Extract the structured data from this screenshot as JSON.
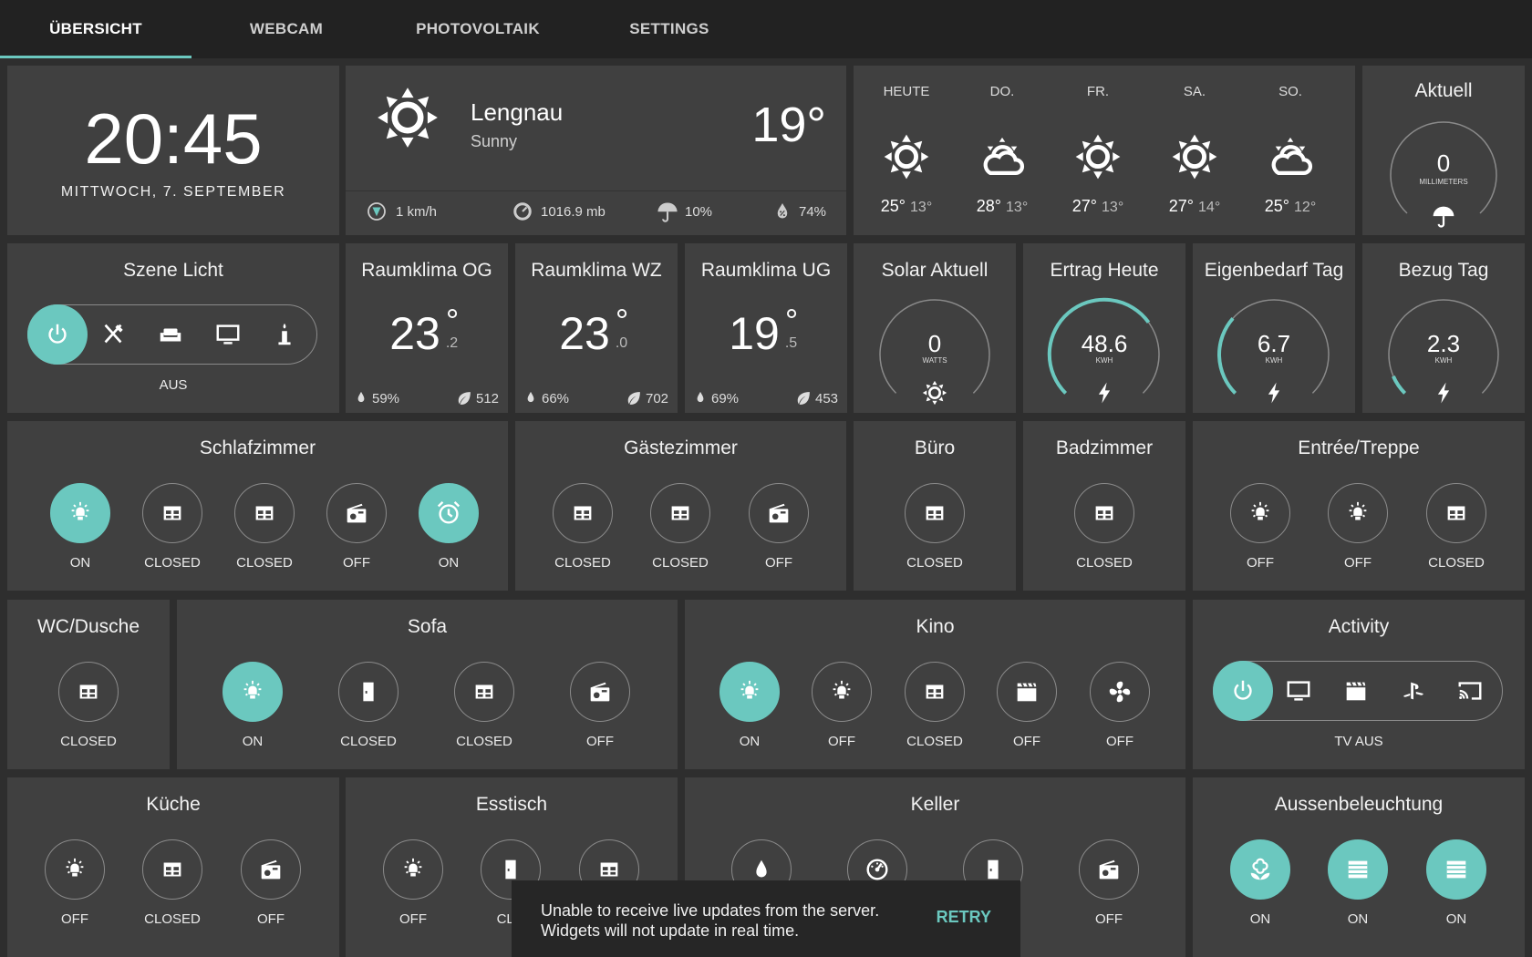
{
  "tabs": [
    "ÜBERSICHT",
    "WEBCAM",
    "PHOTOVOLTAIK",
    "SETTINGS"
  ],
  "clock": {
    "time": "20:45",
    "date": "MITTWOCH, 7. SEPTEMBER"
  },
  "weather": {
    "location": "Lengnau",
    "condition": "Sunny",
    "temp": "19°",
    "wind": "1 km/h",
    "pressure": "1016.9 mb",
    "rain_chance": "10%",
    "humidity": "74%"
  },
  "forecast": [
    {
      "day": "HEUTE",
      "icon": "sun-icon",
      "hi": "25°",
      "lo": "13°"
    },
    {
      "day": "DO.",
      "icon": "partly-cloudy-icon",
      "hi": "28°",
      "lo": "13°"
    },
    {
      "day": "FR.",
      "icon": "sun-icon",
      "hi": "27°",
      "lo": "13°"
    },
    {
      "day": "SA.",
      "icon": "sun-icon",
      "hi": "27°",
      "lo": "14°"
    },
    {
      "day": "SO.",
      "icon": "partly-cloudy-icon",
      "hi": "25°",
      "lo": "12°"
    }
  ],
  "rain": {
    "title": "Aktuell",
    "value": "0",
    "unit": "MILLIMETERS"
  },
  "scene": {
    "title": "Szene Licht",
    "status": "AUS"
  },
  "climate": [
    {
      "title": "Raumklima OG",
      "temp": "23",
      "deg": "°",
      "dec": ".2",
      "hum": "59%",
      "co2": "512"
    },
    {
      "title": "Raumklima WZ",
      "temp": "23",
      "deg": "°",
      "dec": ".0",
      "hum": "66%",
      "co2": "702"
    },
    {
      "title": "Raumklima UG",
      "temp": "19",
      "deg": "°",
      "dec": ".5",
      "hum": "69%",
      "co2": "453"
    }
  ],
  "gauges": [
    {
      "title": "Solar Aktuell",
      "value": "0",
      "unit": "WATTS",
      "fraction": 0
    },
    {
      "title": "Ertrag Heute",
      "value": "48.6",
      "unit": "KWH",
      "fraction": 0.7
    },
    {
      "title": "Eigenbedarf Tag",
      "value": "6.7",
      "unit": "KWH",
      "fraction": 0.32
    },
    {
      "title": "Bezug Tag",
      "value": "2.3",
      "unit": "KWH",
      "fraction": 0.08
    }
  ],
  "rooms": {
    "schlafzimmer": {
      "title": "Schlafzimmer",
      "states": [
        "ON",
        "CLOSED",
        "CLOSED",
        "OFF",
        "ON"
      ]
    },
    "gaestezimmer": {
      "title": "Gästezimmer",
      "states": [
        "CLOSED",
        "CLOSED",
        "OFF"
      ]
    },
    "buero": {
      "title": "Büro",
      "states": [
        "CLOSED"
      ]
    },
    "badzimmer": {
      "title": "Badzimmer",
      "states": [
        "CLOSED"
      ]
    },
    "entree": {
      "title": "Entrée/Treppe",
      "states": [
        "OFF",
        "OFF",
        "CLOSED"
      ]
    },
    "wc": {
      "title": "WC/Dusche",
      "states": [
        "CLOSED"
      ]
    },
    "sofa": {
      "title": "Sofa",
      "states": [
        "ON",
        "CLOSED",
        "CLOSED",
        "OFF"
      ]
    },
    "kino": {
      "title": "Kino",
      "states": [
        "ON",
        "OFF",
        "CLOSED",
        "OFF",
        "OFF"
      ]
    },
    "kueche": {
      "title": "Küche",
      "states": [
        "OFF",
        "CLOSED",
        "OFF"
      ]
    },
    "esstisch": {
      "title": "Esstisch",
      "states": [
        "OFF",
        "CLO"
      ]
    },
    "keller": {
      "title": "Keller",
      "states": [
        "OFF"
      ]
    },
    "aussen": {
      "title": "Aussenbeleuchtung",
      "states": [
        "ON",
        "ON",
        "ON"
      ]
    }
  },
  "activity": {
    "title": "Activity",
    "status": "TV AUS"
  },
  "snackbar": {
    "line1": "Unable to receive live updates from the server.",
    "line2": "Widgets will not update in real time.",
    "action": "RETRY"
  },
  "colors": {
    "accent": "#6bc8bf",
    "card": "#404040",
    "background": "#2e2e2e",
    "tabbar": "#222222"
  }
}
